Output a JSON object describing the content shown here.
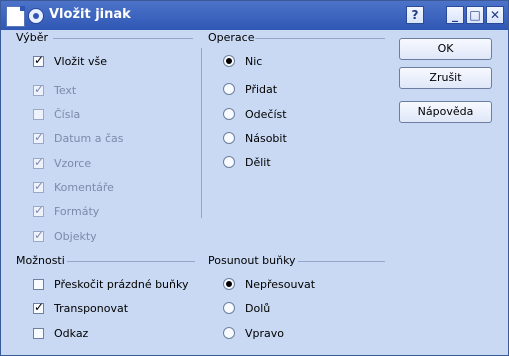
{
  "window": {
    "title": "Vložit jinak"
  },
  "selection": {
    "title": "Výběr",
    "items": [
      {
        "label": "Vložit vše",
        "checked": true,
        "enabled": true
      },
      {
        "label": "Text",
        "checked": true,
        "enabled": false
      },
      {
        "label": "Čísla",
        "checked": false,
        "enabled": false
      },
      {
        "label": "Datum a čas",
        "checked": true,
        "enabled": false
      },
      {
        "label": "Vzorce",
        "checked": true,
        "enabled": false
      },
      {
        "label": "Komentáře",
        "checked": true,
        "enabled": false
      },
      {
        "label": "Formáty",
        "checked": true,
        "enabled": false
      },
      {
        "label": "Objekty",
        "checked": true,
        "enabled": false
      }
    ]
  },
  "operations": {
    "title": "Operace",
    "items": [
      {
        "label": "Nic",
        "checked": true
      },
      {
        "label": "Přidat",
        "checked": false
      },
      {
        "label": "Odečíst",
        "checked": false
      },
      {
        "label": "Násobit",
        "checked": false
      },
      {
        "label": "Dělit",
        "checked": false
      }
    ]
  },
  "options": {
    "title": "Možnosti",
    "items": [
      {
        "label": "Přeskočit prázdné buňky",
        "checked": false
      },
      {
        "label": "Transponovat",
        "checked": true
      },
      {
        "label": "Odkaz",
        "checked": false
      }
    ]
  },
  "shift": {
    "title": "Posunout buňky",
    "items": [
      {
        "label": "Nepřesouvat",
        "checked": true
      },
      {
        "label": "Dolů",
        "checked": false
      },
      {
        "label": "Vpravo",
        "checked": false
      }
    ]
  },
  "buttons": {
    "ok": "OK",
    "cancel": "Zrušit",
    "help": "Nápověda"
  },
  "titlebar": {
    "help": "?",
    "minimize": "_",
    "maximize": "□",
    "close": "✕"
  }
}
